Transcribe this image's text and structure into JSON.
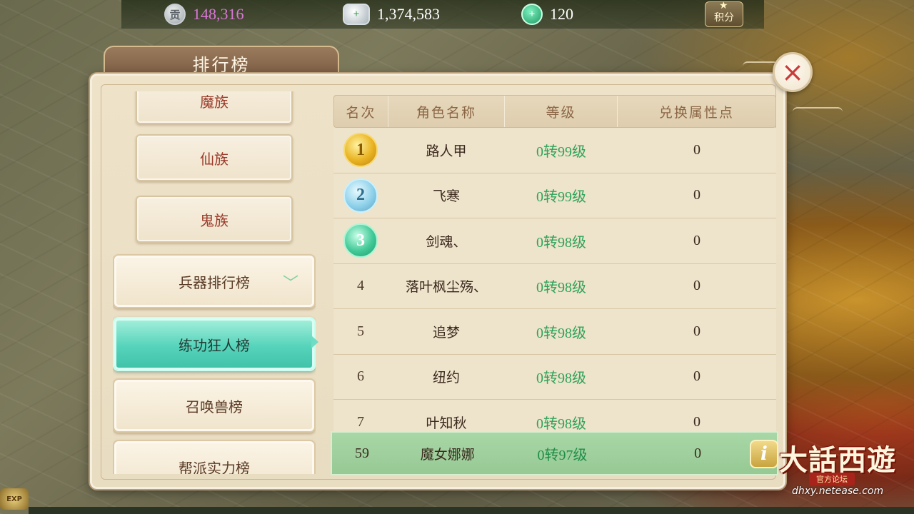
{
  "currencies": [
    {
      "icon": "contribution-icon",
      "glyph": "贡",
      "value": "148,316"
    },
    {
      "icon": "silver-icon",
      "glyph": "+",
      "value": "1,374,583"
    },
    {
      "icon": "jade-icon",
      "glyph": "+",
      "value": "120"
    }
  ],
  "score_button": {
    "label": "积分",
    "icon": "star-icon"
  },
  "panel_title": "排行榜",
  "close_icon": "×",
  "categories_small": [
    "魔族",
    "仙族",
    "鬼族"
  ],
  "categories_big": [
    {
      "label": "兵器排行榜",
      "expandable": true
    },
    {
      "label": "练功狂人榜",
      "active": true
    },
    {
      "label": "召唤兽榜"
    },
    {
      "label": "帮派实力榜"
    }
  ],
  "expand_icon": "chevron-down-icon",
  "table": {
    "headers": [
      "名次",
      "角色名称",
      "等级",
      "兑换属性点"
    ],
    "rows": [
      {
        "rank": "1",
        "medal": "gold",
        "name": "路人甲",
        "level": "0转99级",
        "points": "0"
      },
      {
        "rank": "2",
        "medal": "silver",
        "name": "飞寒",
        "level": "0转99级",
        "points": "0"
      },
      {
        "rank": "3",
        "medal": "jade",
        "name": "剑魂、",
        "level": "0转98级",
        "points": "0"
      },
      {
        "rank": "4",
        "name": "落叶枫尘殇、",
        "level": "0转98级",
        "points": "0"
      },
      {
        "rank": "5",
        "name": "追梦",
        "level": "0转98级",
        "points": "0"
      },
      {
        "rank": "6",
        "name": "纽约",
        "level": "0转98级",
        "points": "0"
      },
      {
        "rank": "7",
        "name": "叶知秋",
        "level": "0转98级",
        "points": "0"
      }
    ],
    "my_row": {
      "rank": "59",
      "name": "魔女娜娜",
      "level": "0转97级",
      "points": "0"
    }
  },
  "info_button": "i",
  "watermark": {
    "title": "大話西遊",
    "subtitle": "官方论坛",
    "url": "dhxy.netease.com"
  },
  "exp_badge": "EXP",
  "colors": {
    "active_tab": "#56d3bb",
    "level_text": "#2ea35a",
    "my_row_bg": "#a9d7a7",
    "close_x": "#c93a3a"
  }
}
